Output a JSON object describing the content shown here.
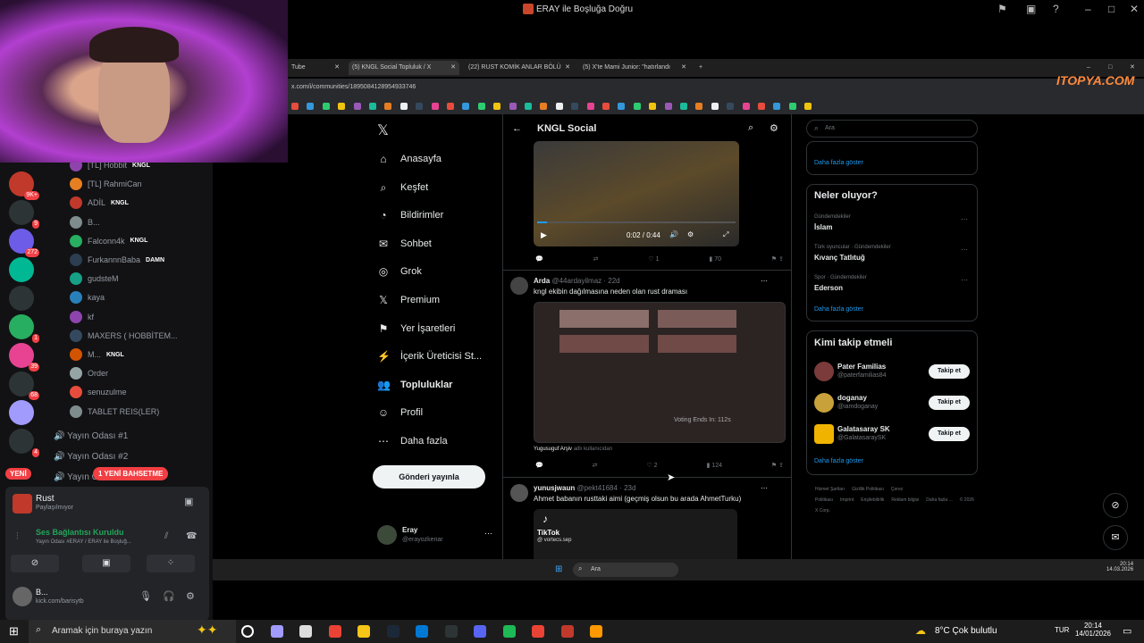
{
  "window": {
    "title": "ERAY ile Boşluğa Doğru"
  },
  "discord": {
    "members": [
      {
        "name": "[TL] Hobbit",
        "tag": "KNGL"
      },
      {
        "name": "[TL] RahmiCan",
        "tag": ""
      },
      {
        "name": "ADİL",
        "tag": "KNGL"
      },
      {
        "name": "B...",
        "tag": ""
      },
      {
        "name": "Falconn4k",
        "tag": "KNGL"
      },
      {
        "name": "FurkannnBaba",
        "tag": "DAMN"
      },
      {
        "name": "gudsteM",
        "tag": ""
      },
      {
        "name": "kaya",
        "tag": ""
      },
      {
        "name": "kf",
        "tag": ""
      },
      {
        "name": "MAXERS ( HOBBİTEM...",
        "tag": ""
      },
      {
        "name": "M...",
        "tag": "KNGL"
      },
      {
        "name": "Order",
        "tag": ""
      },
      {
        "name": "senuzulme",
        "tag": ""
      },
      {
        "name": "TABLET REIS(LER)",
        "tag": ""
      }
    ],
    "server_badges": [
      "9K+",
      "9",
      "272",
      "",
      "",
      "1",
      "39",
      "68",
      "",
      "4"
    ],
    "channels": [
      "Yayın Odası #1",
      "Yayın Odası #2",
      "Yayın O"
    ],
    "new_badge": "YENİ",
    "mention_badge": "1 YENİ BAHSETME",
    "activity": {
      "name": "Rust",
      "status": "Paylaşılmıyor"
    },
    "voice": {
      "status": "Ses Bağlantısı Kuruldu",
      "detail": "Yayın Odası #ERAY / ERAY ile Boşluğ..."
    },
    "user": {
      "name": "B...",
      "status": "kick.com/barisytb"
    }
  },
  "browser": {
    "tabs": [
      {
        "label": "Tube",
        "active": false
      },
      {
        "label": "(5) KNGL Social Topluluk / X",
        "active": true
      },
      {
        "label": "(22) RUST KOMİK ANLAR BÖLÜ",
        "active": false
      },
      {
        "label": "(5) X'te Mami Junior: \"hatırlandı",
        "active": false
      }
    ],
    "url": "x.com/i/communities/1895084128954933746",
    "watermark": "ITOPYA.COM"
  },
  "x": {
    "nav": [
      {
        "label": "Anasayfa",
        "icon": "home-icon",
        "glyph": "⌂"
      },
      {
        "label": "Keşfet",
        "icon": "search-icon",
        "glyph": "⌕"
      },
      {
        "label": "Bildirimler",
        "icon": "bell-icon",
        "glyph": "◔"
      },
      {
        "label": "Sohbet",
        "icon": "mail-icon",
        "glyph": "✉"
      },
      {
        "label": "Grok",
        "icon": "grok-icon",
        "glyph": "◎"
      },
      {
        "label": "Premium",
        "icon": "x-logo-icon",
        "glyph": "𝕏"
      },
      {
        "label": "Yer İşaretleri",
        "icon": "bookmark-icon",
        "glyph": "⚑"
      },
      {
        "label": "İçerik Üreticisi St...",
        "icon": "creator-icon",
        "glyph": "⚡"
      },
      {
        "label": "Topluluklar",
        "icon": "communities-icon",
        "glyph": "👥"
      },
      {
        "label": "Profil",
        "icon": "profile-icon",
        "glyph": "☺"
      },
      {
        "label": "Daha fazla",
        "icon": "more-icon",
        "glyph": "⋯"
      }
    ],
    "post_button": "Gönderi yayınla",
    "account": {
      "name": "Eray",
      "handle": "@erayozkenar"
    },
    "community_title": "KNGL Social",
    "video": {
      "time": "0:02 / 0:44",
      "replies": "",
      "reposts": "",
      "likes": "1",
      "views": "70"
    },
    "posts": [
      {
        "author": "Arda",
        "handle": "@44ardayilmaz · 22d",
        "text": "kngl ekibin dağılmasına neden olan rust draması",
        "poll_text": "Voting Ends In: 112s",
        "annotation": "Yugusuguf Arşiv",
        "annotation_sub": "adlı kullanıcıdan",
        "likes": "2",
        "views": "124"
      },
      {
        "author": "yunusjwaun",
        "handle": "@pekt41684 · 23d",
        "text": "Ahmet babanın rusttaki aimi (geçmiş olsun bu arada AhmetTurku)",
        "tiktok": "TikTok",
        "tiktok_handle": "@ vortecs.sep"
      }
    ],
    "search_placeholder": "Ara",
    "show_more": "Daha fazla göster",
    "trends_title": "Neler oluyor?",
    "trends": [
      {
        "context": "Gündemdekiler",
        "name": "İslam"
      },
      {
        "context": "Türk oyuncular · Gündemdekiler",
        "name": "Kıvanç Tatlıtuğ"
      },
      {
        "context": "Spor · Gündemdekiler",
        "name": "Ederson"
      }
    ],
    "follow_title": "Kimi takip etmeli",
    "follow": [
      {
        "name": "Pater Familias",
        "handle": "@paterfamilias84",
        "button": "Takip et"
      },
      {
        "name": "doganay",
        "handle": "@iamdoganay",
        "button": "Takip et"
      },
      {
        "name": "Galatasaray SK",
        "handle": "@GalatasaraySK",
        "button": "Takip et"
      }
    ],
    "footer": [
      "Hizmet Şartları",
      "Gizlilik Politikası",
      "Çerez Politikası",
      "Imprint",
      "Erişilebilirlik",
      "Reklam bilgisi",
      "Daha fazla ...",
      "© 2026 X Corp."
    ]
  },
  "inner_taskbar": {
    "search": "Ara",
    "time": "20:14",
    "date": "14.03.2026"
  },
  "taskbar": {
    "search": "Aramak için buraya yazın",
    "weather": "8°C  Çok bulutlu",
    "lang": "TUR",
    "time": "20:14",
    "date": "14/01/2026"
  }
}
